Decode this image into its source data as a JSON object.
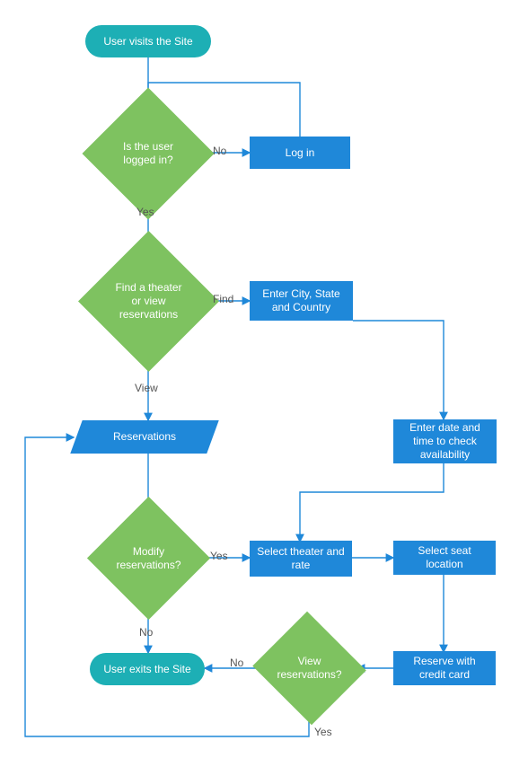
{
  "flowchart": {
    "nodes": {
      "start": "User visits the Site",
      "loggedIn": "Is the user logged in?",
      "login": "Log in",
      "findOrView": "Find a theater or view reservations",
      "enterCity": "Enter City, State and Country",
      "reservations": "Reservations",
      "enterDate": "Enter date and time to check availability",
      "modify": "Modify reservations?",
      "selectTheater": "Select theater and rate",
      "selectSeat": "Select seat location",
      "reserveCard": "Reserve with credit card",
      "viewRes": "View reservations?",
      "exit": "User exits the Site"
    },
    "edges": {
      "no": "No",
      "yes": "Yes",
      "find": "Find",
      "view": "View"
    }
  }
}
